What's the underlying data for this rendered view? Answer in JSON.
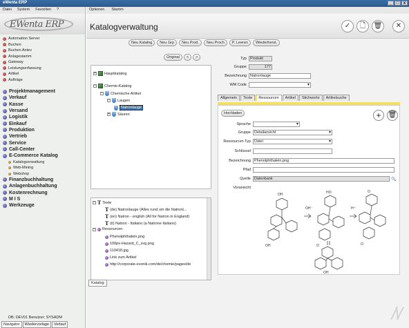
{
  "window": {
    "title": "eWenta ERP",
    "controls": [
      "_",
      "□",
      "x"
    ]
  },
  "app": {
    "menu": [
      "Datei",
      "System",
      "Favoriten",
      "?"
    ],
    "logo": "EWenta ERP"
  },
  "sidebar": {
    "items_small": [
      "Automation Server",
      "Buchen",
      "Buchen Antev",
      "Anlagestamm",
      "Gateway",
      "Leistungserfassung",
      "Artikel",
      "Aufträge"
    ],
    "items_big": [
      "Projektmanagement",
      "Verkauf",
      "Kasse",
      "Versand",
      "Logistik",
      "Einkauf",
      "Produktion",
      "Vertrieb",
      "Service",
      "Call-Center",
      "E-Commerce Katalog"
    ],
    "items_sub": [
      "Katalogverwaltung",
      "Web-Mining",
      "Webshop"
    ],
    "items_big2": [
      "Finanzbuchhaltung",
      "Anlagenbuchhaltung",
      "Kostenrechnung",
      "M I S",
      "Werkzeuge"
    ],
    "footer": "DB: DEV01 Benutzer: SYSADM",
    "tabs": [
      "Navigator",
      "Wiedervorlage",
      "Verlauf"
    ]
  },
  "main": {
    "menu": [
      "Optionen",
      "Stamm"
    ],
    "title": "Katalogverwaltung",
    "actions": [
      "Neu Katalog",
      "Neu Grp",
      "Neu Prod.",
      "Neu Proch",
      "P. Leeren",
      "Wiederherst."
    ],
    "tree_buttons": [
      "Original",
      "<",
      ">"
    ],
    "tree": {
      "root1": "Hauptkatalog",
      "root2": "Chemie-Katalog",
      "child": "Chemische Artikel",
      "laugen": "Laugen",
      "selected": "Natronlauge",
      "saeuren": "Säuren"
    },
    "lower": {
      "texte": "Texte",
      "t1": "(de) Natronlauge (Alles rund um die Natront...",
      "t2": "(en) Natron - english (All for Natron in England)",
      "t3": "(it) Natron - Italiano (a Natrone Italiano)",
      "ressourcen": "Ressourcen",
      "r1": "Phenolphthalein.png",
      "r2": "100px-Hazard_C_svg.png",
      "r3": "110418.jpg",
      "r4": "Link zum Artikel",
      "r5": "http://corporate.evonik.com/de/chemie/pages/de"
    },
    "form": {
      "typ_label": "Typ",
      "typ_value": "Produkt",
      "gruppe_label": "Gruppe",
      "gruppe_value": "177",
      "bez_label": "Bezeichnung",
      "bez_value": "Natronlauge",
      "wm_label": "WM Code",
      "wm_value": ""
    },
    "tabs": [
      "Allgemein",
      "Texte",
      "Ressourcen",
      "Artikel",
      "Stichworte",
      "Artikelsuche"
    ],
    "panel": {
      "upload": "Hochladen",
      "sprache_label": "Sprache",
      "sprache_value": "",
      "gruppe_label": "Gruppe",
      "gruppe_value": "Detailansicht",
      "rtyp_label": "Ressourcen Typ",
      "rtyp_value": "Datei",
      "schluessel_label": "Schlüssel",
      "schluessel_value": "",
      "bez_label": "Bezeichnung",
      "bez_value": "Phenolphthalein.png",
      "pfad_label": "Pfad",
      "pfad_value": "",
      "quelle_label": "Quelle",
      "quelle_value": "Datenbank",
      "vorschau_label": "Voransicht"
    },
    "bottom_tab": "Katalog"
  },
  "icons": [
    "check-icon",
    "document-icon",
    "trash-icon",
    "close-icon",
    "plus-icon"
  ]
}
